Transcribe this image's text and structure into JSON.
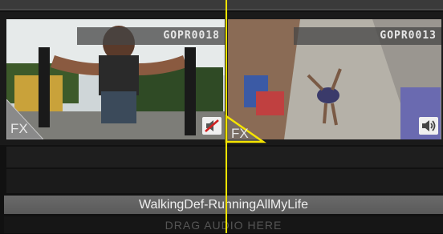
{
  "clips": [
    {
      "name": "GOPR0018",
      "fx_label": "FX",
      "audio_icon": "speaker-muted-icon"
    },
    {
      "name": "GOPR0013",
      "fx_label": "FX",
      "audio_icon": "speaker-on-icon"
    }
  ],
  "music_track": {
    "label": "WalkingDef-RunningAllMyLife"
  },
  "drop_zone": {
    "label": "DRAG AUDIO HERE"
  },
  "colors": {
    "playhead": "#f5e400",
    "background": "#111111",
    "music_bar": "#646464"
  }
}
